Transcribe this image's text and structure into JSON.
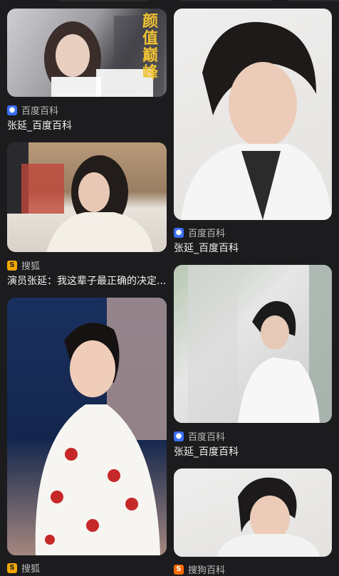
{
  "cards": [
    {
      "source": "百度百科",
      "source_icon": "baidu-paw-icon",
      "title": "张延_百度百科",
      "overlay": "颜值巅峰"
    },
    {
      "source": "百度百科",
      "source_icon": "baidu-paw-icon",
      "title": "张延_百度百科"
    },
    {
      "source": "搜狐",
      "source_icon": "sohu-s-icon",
      "title": "演员张延：我这辈子最正确的决定..."
    },
    {
      "source": "百度百科",
      "source_icon": "baidu-paw-icon",
      "title": "张延_百度百科"
    },
    {
      "source": "搜狐",
      "source_icon": "sohu-s-icon",
      "title": ""
    },
    {
      "source": "搜狗百科",
      "source_icon": "sogou-icon",
      "title": ""
    }
  ]
}
